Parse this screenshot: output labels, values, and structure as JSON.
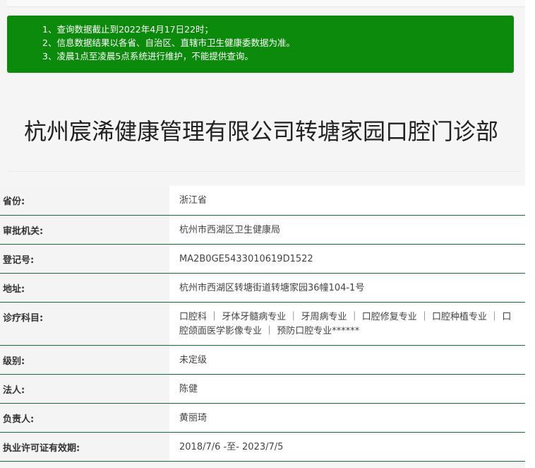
{
  "notice": {
    "lines": [
      "1、查询数据截止到2022年4月17日22时；",
      "2、信息数据结果以各省、自治区、直辖市卫生健康委数据为准。",
      "3、凌晨1点至凌晨5点系统进行维护，不能提供查询。"
    ]
  },
  "title": "杭州宸浠健康管理有限公司转塘家园口腔门诊部",
  "rows": [
    {
      "label": "省份:",
      "value": "浙江省"
    },
    {
      "label": "审批机关:",
      "value": "杭州市西湖区卫生健康局"
    },
    {
      "label": "登记号:",
      "value": "MA2B0GE5433010619D1522"
    },
    {
      "label": "地址:",
      "value": "杭州市西湖区转塘街道转塘家园36幢104-1号"
    },
    {
      "label": "诊疗科目:",
      "value": "口腔科 ｜ 牙体牙髓病专业 ｜ 牙周病专业 ｜ 口腔修复专业 ｜ 口腔种植专业 ｜ 口腔颌面医学影像专业 ｜ 预防口腔专业******"
    },
    {
      "label": "级别:",
      "value": "未定级"
    },
    {
      "label": "法人:",
      "value": "陈健"
    },
    {
      "label": "负责人:",
      "value": "黄丽琦"
    },
    {
      "label": "执业许可证有效期:",
      "value": "2018/7/6 -至- 2023/7/5"
    }
  ],
  "colors": {
    "notice_bg": "#0b8a0b",
    "row_border": "#1a6b38"
  }
}
